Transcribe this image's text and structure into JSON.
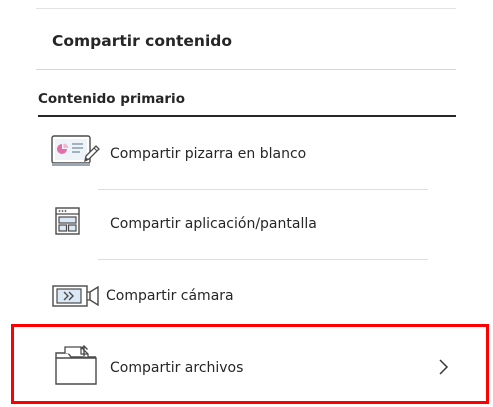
{
  "panel": {
    "title": "Compartir contenido"
  },
  "section": {
    "heading": "Contenido primario"
  },
  "items": [
    {
      "label": "Compartir pizarra en blanco",
      "icon": "whiteboard-pencil-icon"
    },
    {
      "label": "Compartir aplicación/pantalla",
      "icon": "application-window-icon"
    },
    {
      "label": "Compartir cámara",
      "icon": "camera-icon"
    },
    {
      "label": "Compartir archivos",
      "icon": "file-folder-icon",
      "trailing_icon": "chevron-right-icon"
    }
  ],
  "colors": {
    "text": "#262626",
    "divider": "#dedede",
    "icon_accent": "#e36fa8",
    "icon_blue": "#dbe8f5",
    "highlight": "#ff0000"
  }
}
